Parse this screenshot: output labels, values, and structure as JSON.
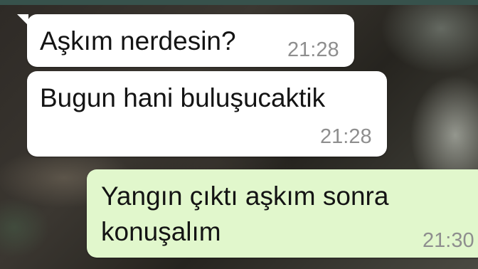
{
  "header": {
    "accent_color": "#37524c"
  },
  "messages": [
    {
      "direction": "incoming",
      "text": "Aşkım nerdesin?",
      "time": "21:28"
    },
    {
      "direction": "incoming",
      "text": "Bugun hani buluşucaktik",
      "time": "21:28"
    },
    {
      "direction": "outgoing",
      "lines": [
        "Yangın çıktı aşkım sonra",
        "konuşalım"
      ],
      "time": "21:30"
    }
  ],
  "colors": {
    "incoming_bubble": "#ffffff",
    "outgoing_bubble": "#e1f7cc",
    "timestamp": "#8e8e8e",
    "message_text": "#141414"
  }
}
